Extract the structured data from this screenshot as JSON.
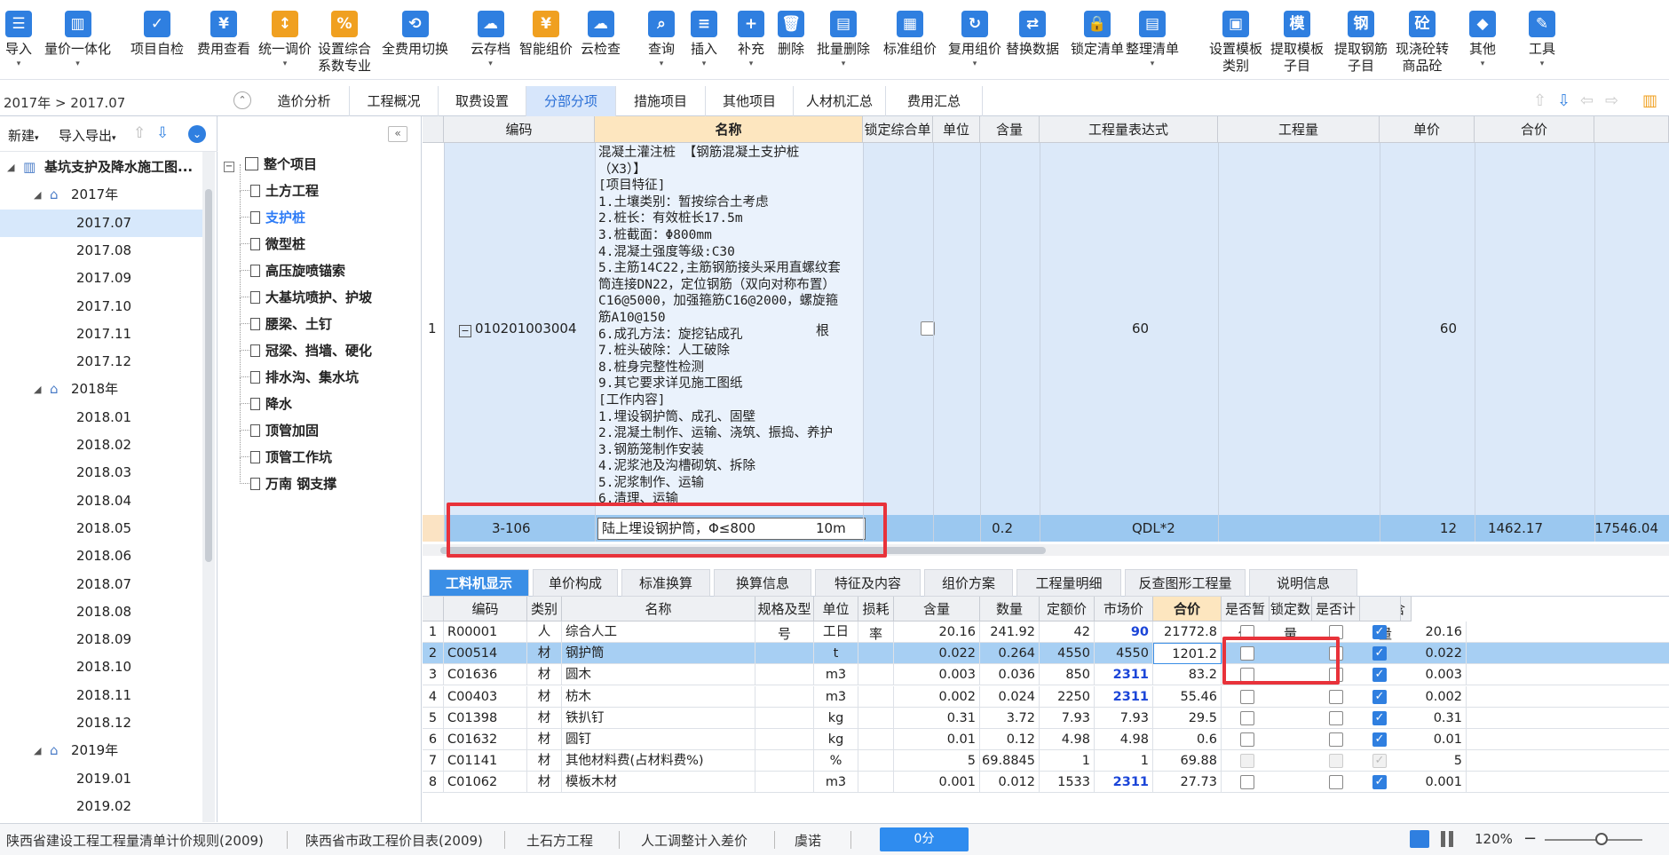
{
  "toolbar": {
    "buttons": [
      {
        "label": "导入",
        "sub": "",
        "icon": "import-icon",
        "caret": true
      },
      {
        "label": "量价一体化",
        "sub": "",
        "icon": "price-integration-icon",
        "caret": true
      },
      {
        "label": "项目自检",
        "sub": "",
        "icon": "self-check-icon",
        "caret": false
      },
      {
        "label": "费用查看",
        "sub": "",
        "icon": "fee-view-icon",
        "caret": false
      },
      {
        "label": "统一调价",
        "sub": "",
        "icon": "adjust-price-icon",
        "caret": true
      },
      {
        "label": "设置综合",
        "sub": "系数专业",
        "icon": "coefficient-icon",
        "caret": false
      },
      {
        "label": "全费用切换",
        "sub": "",
        "icon": "full-fee-switch-icon",
        "caret": false
      },
      {
        "label": "云存档",
        "sub": "",
        "icon": "cloud-save-icon",
        "caret": true
      },
      {
        "label": "智能组价",
        "sub": "",
        "icon": "smart-price-icon",
        "caret": false
      },
      {
        "label": "云检查",
        "sub": "",
        "icon": "cloud-check-icon",
        "caret": false
      },
      {
        "label": "查询",
        "sub": "",
        "icon": "query-icon",
        "caret": true
      },
      {
        "label": "插入",
        "sub": "",
        "icon": "insert-icon",
        "caret": true
      },
      {
        "label": "补充",
        "sub": "",
        "icon": "supplement-icon",
        "caret": true
      },
      {
        "label": "删除",
        "sub": "",
        "icon": "delete-icon",
        "caret": false
      },
      {
        "label": "批量删除",
        "sub": "",
        "icon": "batch-delete-icon",
        "caret": true
      },
      {
        "label": "标准组价",
        "sub": "",
        "icon": "standard-price-icon",
        "caret": false
      },
      {
        "label": "复用组价",
        "sub": "",
        "icon": "reuse-price-icon",
        "caret": true
      },
      {
        "label": "替换数据",
        "sub": "",
        "icon": "replace-data-icon",
        "caret": false
      },
      {
        "label": "锁定清单",
        "sub": "",
        "icon": "lock-list-icon",
        "caret": false
      },
      {
        "label": "整理清单",
        "sub": "",
        "icon": "organize-list-icon",
        "caret": true
      },
      {
        "label": "设置模板",
        "sub": "类别",
        "icon": "template-category-icon",
        "caret": false
      },
      {
        "label": "提取模板",
        "sub": "子目",
        "icon": "extract-template-icon",
        "caret": false
      },
      {
        "label": "提取钢筋",
        "sub": "子目",
        "icon": "extract-rebar-icon",
        "caret": false
      },
      {
        "label": "现浇砼转",
        "sub": "商品砼",
        "icon": "concrete-convert-icon",
        "caret": false
      },
      {
        "label": "其他",
        "sub": "",
        "icon": "other-icon",
        "caret": true
      },
      {
        "label": "工具",
        "sub": "",
        "icon": "tools-icon",
        "caret": true
      }
    ],
    "icon_glyphs": {
      "import-icon": "☰",
      "price-integration-icon": "▥",
      "self-check-icon": "✓",
      "fee-view-icon": "¥",
      "adjust-price-icon": "↕",
      "coefficient-icon": "%",
      "full-fee-switch-icon": "⟲",
      "cloud-save-icon": "☁",
      "smart-price-icon": "¥",
      "cloud-check-icon": "☁",
      "query-icon": "⌕",
      "insert-icon": "≡",
      "supplement-icon": "+",
      "delete-icon": "🗑",
      "batch-delete-icon": "▤",
      "standard-price-icon": "▦",
      "reuse-price-icon": "↻",
      "replace-data-icon": "⇄",
      "lock-list-icon": "🔒",
      "organize-list-icon": "▤",
      "template-category-icon": "▣",
      "extract-template-icon": "模",
      "extract-rebar-icon": "钢",
      "concrete-convert-icon": "砼",
      "other-icon": "◆",
      "tools-icon": "✎"
    },
    "icon_colors": {
      "primary": "#2f7fe0",
      "accent": "#f0a020",
      "danger": "#e04848"
    }
  },
  "breadcrumb": "2017年 > 2017.07",
  "tabs": [
    "造价分析",
    "工程概况",
    "取费设置",
    "分部分项",
    "措施项目",
    "其他项目",
    "人材机汇总",
    "费用汇总"
  ],
  "active_tab": "分部分项",
  "left_panel": {
    "new_label": "新建",
    "import_export_label": "导入导出",
    "tree": [
      {
        "label": "基坑支护及降水施工图...",
        "level": 0,
        "expanded": true
      },
      {
        "label": "2017年",
        "level": 1,
        "expanded": true
      },
      {
        "label": "2017.07",
        "level": 2
      },
      {
        "label": "2017.08",
        "level": 2
      },
      {
        "label": "2017.09",
        "level": 2
      },
      {
        "label": "2017.10",
        "level": 2
      },
      {
        "label": "2017.11",
        "level": 2
      },
      {
        "label": "2017.12",
        "level": 2
      },
      {
        "label": "2018年",
        "level": 1,
        "expanded": true
      },
      {
        "label": "2018.01",
        "level": 2
      },
      {
        "label": "2018.02",
        "level": 2
      },
      {
        "label": "2018.03",
        "level": 2
      },
      {
        "label": "2018.04",
        "level": 2
      },
      {
        "label": "2018.05",
        "level": 2
      },
      {
        "label": "2018.06",
        "level": 2
      },
      {
        "label": "2018.07",
        "level": 2
      },
      {
        "label": "2018.08",
        "level": 2
      },
      {
        "label": "2018.09",
        "level": 2
      },
      {
        "label": "2018.10",
        "level": 2
      },
      {
        "label": "2018.11",
        "level": 2
      },
      {
        "label": "2018.12",
        "level": 2
      },
      {
        "label": "2019年",
        "level": 1,
        "expanded": true
      },
      {
        "label": "2019.01",
        "level": 2
      },
      {
        "label": "2019.02",
        "level": 2
      }
    ],
    "selected": "2017.07"
  },
  "section_tree": {
    "root": "整个项目",
    "items": [
      "土方工程",
      "支护桩",
      "微型桩",
      "高压旋喷锚索",
      "大基坑喷护、护坡",
      "腰梁、土钉",
      "冠梁、挡墙、硬化",
      "排水沟、集水坑",
      "降水",
      "顶管加固",
      "顶管工作坑",
      "万南  钢支撑"
    ],
    "selected": "支护桩"
  },
  "grid": {
    "headers": [
      "编码",
      "名称",
      "锁定综合单价",
      "单位",
      "含量",
      "工程量表达式",
      "工程量",
      "单价",
      "合价"
    ],
    "row1": {
      "index": "1",
      "code": "010201003004",
      "name_text": "混凝土灌注桩 【钢筋混凝土支护桩\n（X3）】\n[项目特征]\n1.土壤类别：暂按综合土考虑\n2.桩长：有效桩长17.5m\n3.桩截面：Φ800mm\n4.混凝土强度等级:C30\n5.主筋14C22,主筋钢筋接头采用直螺纹套\n筒连接DN22，定位钢筋（双向对称布置）\nC16@5000，加强箍筋C16@2000，螺旋箍\n筋A10@150\n6.成孔方法：旋挖钻成孔\n7.桩头破除：人工破除\n8.桩身完整性检测\n9.其它要求详见施工图纸\n[工作内容]\n1.埋设钢护筒、成孔、固壁\n2.混凝土制作、运输、浇筑、振捣、养护\n3.钢筋笼制作安装\n4.泥浆池及沟槽砌筑、拆除\n5.泥浆制作、运输\n6.清理、运输",
      "unit": "根",
      "expr": "60",
      "qty": "60"
    },
    "row2": {
      "code": "3-106",
      "name": "陆上埋设钢护筒，Φ≤800",
      "unit": "10m",
      "content": "0.2",
      "expr": "QDL*2",
      "qty": "12",
      "price": "1462.17",
      "total": "17546.04"
    }
  },
  "bottom_tabs": [
    "工料机显示",
    "单价构成",
    "标准换算",
    "换算信息",
    "特征及内容",
    "组价方案",
    "工程量明细",
    "反查图形工程量",
    "说明信息"
  ],
  "bottom_active": "工料机显示",
  "bottom_grid": {
    "headers": [
      "编码",
      "类别",
      "名称",
      "规格及型号",
      "单位",
      "损耗率",
      "含量",
      "数量",
      "定额价",
      "市场价",
      "合价",
      "是否暂估",
      "锁定数量",
      "是否计价",
      "原始含量"
    ],
    "rows": [
      {
        "idx": "1",
        "code": "R00001",
        "cat": "人",
        "name": "综合人工",
        "spec": "",
        "unit": "工日",
        "loss": "",
        "content": "20.16",
        "qty": "241.92",
        "base": "42",
        "market": "90",
        "market_blue": true,
        "total": "21772.8",
        "est": false,
        "lock": false,
        "priced": true,
        "orig": "20.16"
      },
      {
        "idx": "2",
        "code": "C00514",
        "cat": "材",
        "name": "钢护筒",
        "spec": "",
        "unit": "t",
        "loss": "",
        "content": "0.022",
        "qty": "0.264",
        "base": "4550",
        "market": "4550",
        "market_blue": false,
        "total": "1201.2",
        "est": false,
        "lock": false,
        "priced": true,
        "orig": "0.022"
      },
      {
        "idx": "3",
        "code": "C01636",
        "cat": "材",
        "name": "圆木",
        "spec": "",
        "unit": "m3",
        "loss": "",
        "content": "0.003",
        "qty": "0.036",
        "base": "850",
        "market": "2311",
        "market_blue": true,
        "total": "83.2",
        "est": false,
        "lock": false,
        "priced": true,
        "orig": "0.003"
      },
      {
        "idx": "4",
        "code": "C00403",
        "cat": "材",
        "name": "枋木",
        "spec": "",
        "unit": "m3",
        "loss": "",
        "content": "0.002",
        "qty": "0.024",
        "base": "2250",
        "market": "2311",
        "market_blue": true,
        "total": "55.46",
        "est": false,
        "lock": false,
        "priced": true,
        "orig": "0.002"
      },
      {
        "idx": "5",
        "code": "C01398",
        "cat": "材",
        "name": "铁扒钉",
        "spec": "",
        "unit": "kg",
        "loss": "",
        "content": "0.31",
        "qty": "3.72",
        "base": "7.93",
        "market": "7.93",
        "market_blue": false,
        "total": "29.5",
        "est": false,
        "lock": false,
        "priced": true,
        "orig": "0.31"
      },
      {
        "idx": "6",
        "code": "C01632",
        "cat": "材",
        "name": "圆钉",
        "spec": "",
        "unit": "kg",
        "loss": "",
        "content": "0.01",
        "qty": "0.12",
        "base": "4.98",
        "market": "4.98",
        "market_blue": false,
        "total": "0.6",
        "est": false,
        "lock": false,
        "priced": true,
        "orig": "0.01"
      },
      {
        "idx": "7",
        "code": "C01141",
        "cat": "材",
        "name": "其他材料费(占材料费%)",
        "spec": "",
        "unit": "%",
        "loss": "",
        "content": "5",
        "qty": "69.8845",
        "base": "1",
        "market": "1",
        "market_blue": false,
        "total": "69.88",
        "est": null,
        "lock": null,
        "priced": "disabled",
        "orig": "5"
      },
      {
        "idx": "8",
        "code": "C01062",
        "cat": "材",
        "name": "模板木材",
        "spec": "",
        "unit": "m3",
        "loss": "",
        "content": "0.001",
        "qty": "0.012",
        "base": "1533",
        "market": "2311",
        "market_blue": true,
        "total": "27.73",
        "est": false,
        "lock": false,
        "priced": true,
        "orig": "0.001"
      }
    ]
  },
  "status": {
    "items": [
      "陕西省建设工程工程量清单计价规则(2009)",
      "陕西省市政工程价目表(2009)",
      "土石方工程",
      "人工调整计入差价",
      "虞诺"
    ],
    "progress": "0分",
    "zoom": "120%"
  },
  "colors": {
    "accent": "#2f7fe0",
    "highlight_row": "#9bc8f0",
    "red_box": "#e8323a",
    "header_active": "#fde6bf"
  }
}
